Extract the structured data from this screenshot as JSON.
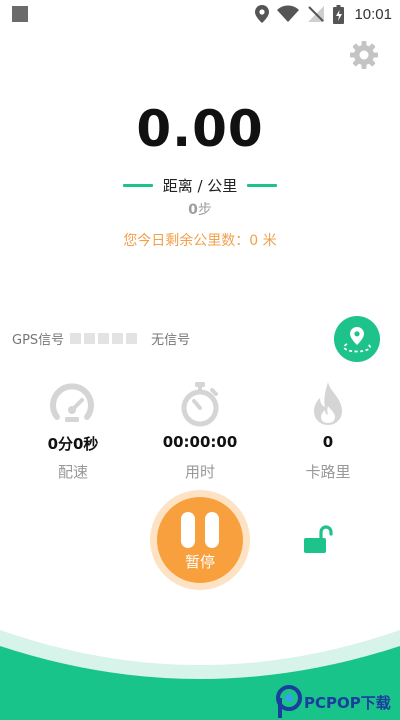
{
  "status_bar": {
    "time": "10:01",
    "icons": [
      "location-pin-icon",
      "wifi-icon",
      "no-signal-icon",
      "battery-charging-icon"
    ]
  },
  "header": {
    "settings_icon": "gear-icon"
  },
  "distance": {
    "value": "0.00",
    "label": "距离 / 公里"
  },
  "steps": {
    "count": "0",
    "unit": "步"
  },
  "remaining_text": "您今日剩余公里数：0 米",
  "gps": {
    "label": "GPS信号",
    "status": "无信号",
    "strength": 0
  },
  "stats": [
    {
      "icon": "speedometer-icon",
      "value": "0分0秒",
      "label": "配速"
    },
    {
      "icon": "stopwatch-icon",
      "value": "00:00:00",
      "label": "用时"
    },
    {
      "icon": "flame-icon",
      "value": "0",
      "label": "卡路里"
    }
  ],
  "controls": {
    "pause_label": "暂停",
    "lock_icon": "unlock-icon"
  },
  "watermark": {
    "text": "PCPOP下载"
  },
  "colors": {
    "accent": "#1ec28b",
    "orange": "#f8a03e",
    "remaining_text": "#f3a04c"
  }
}
